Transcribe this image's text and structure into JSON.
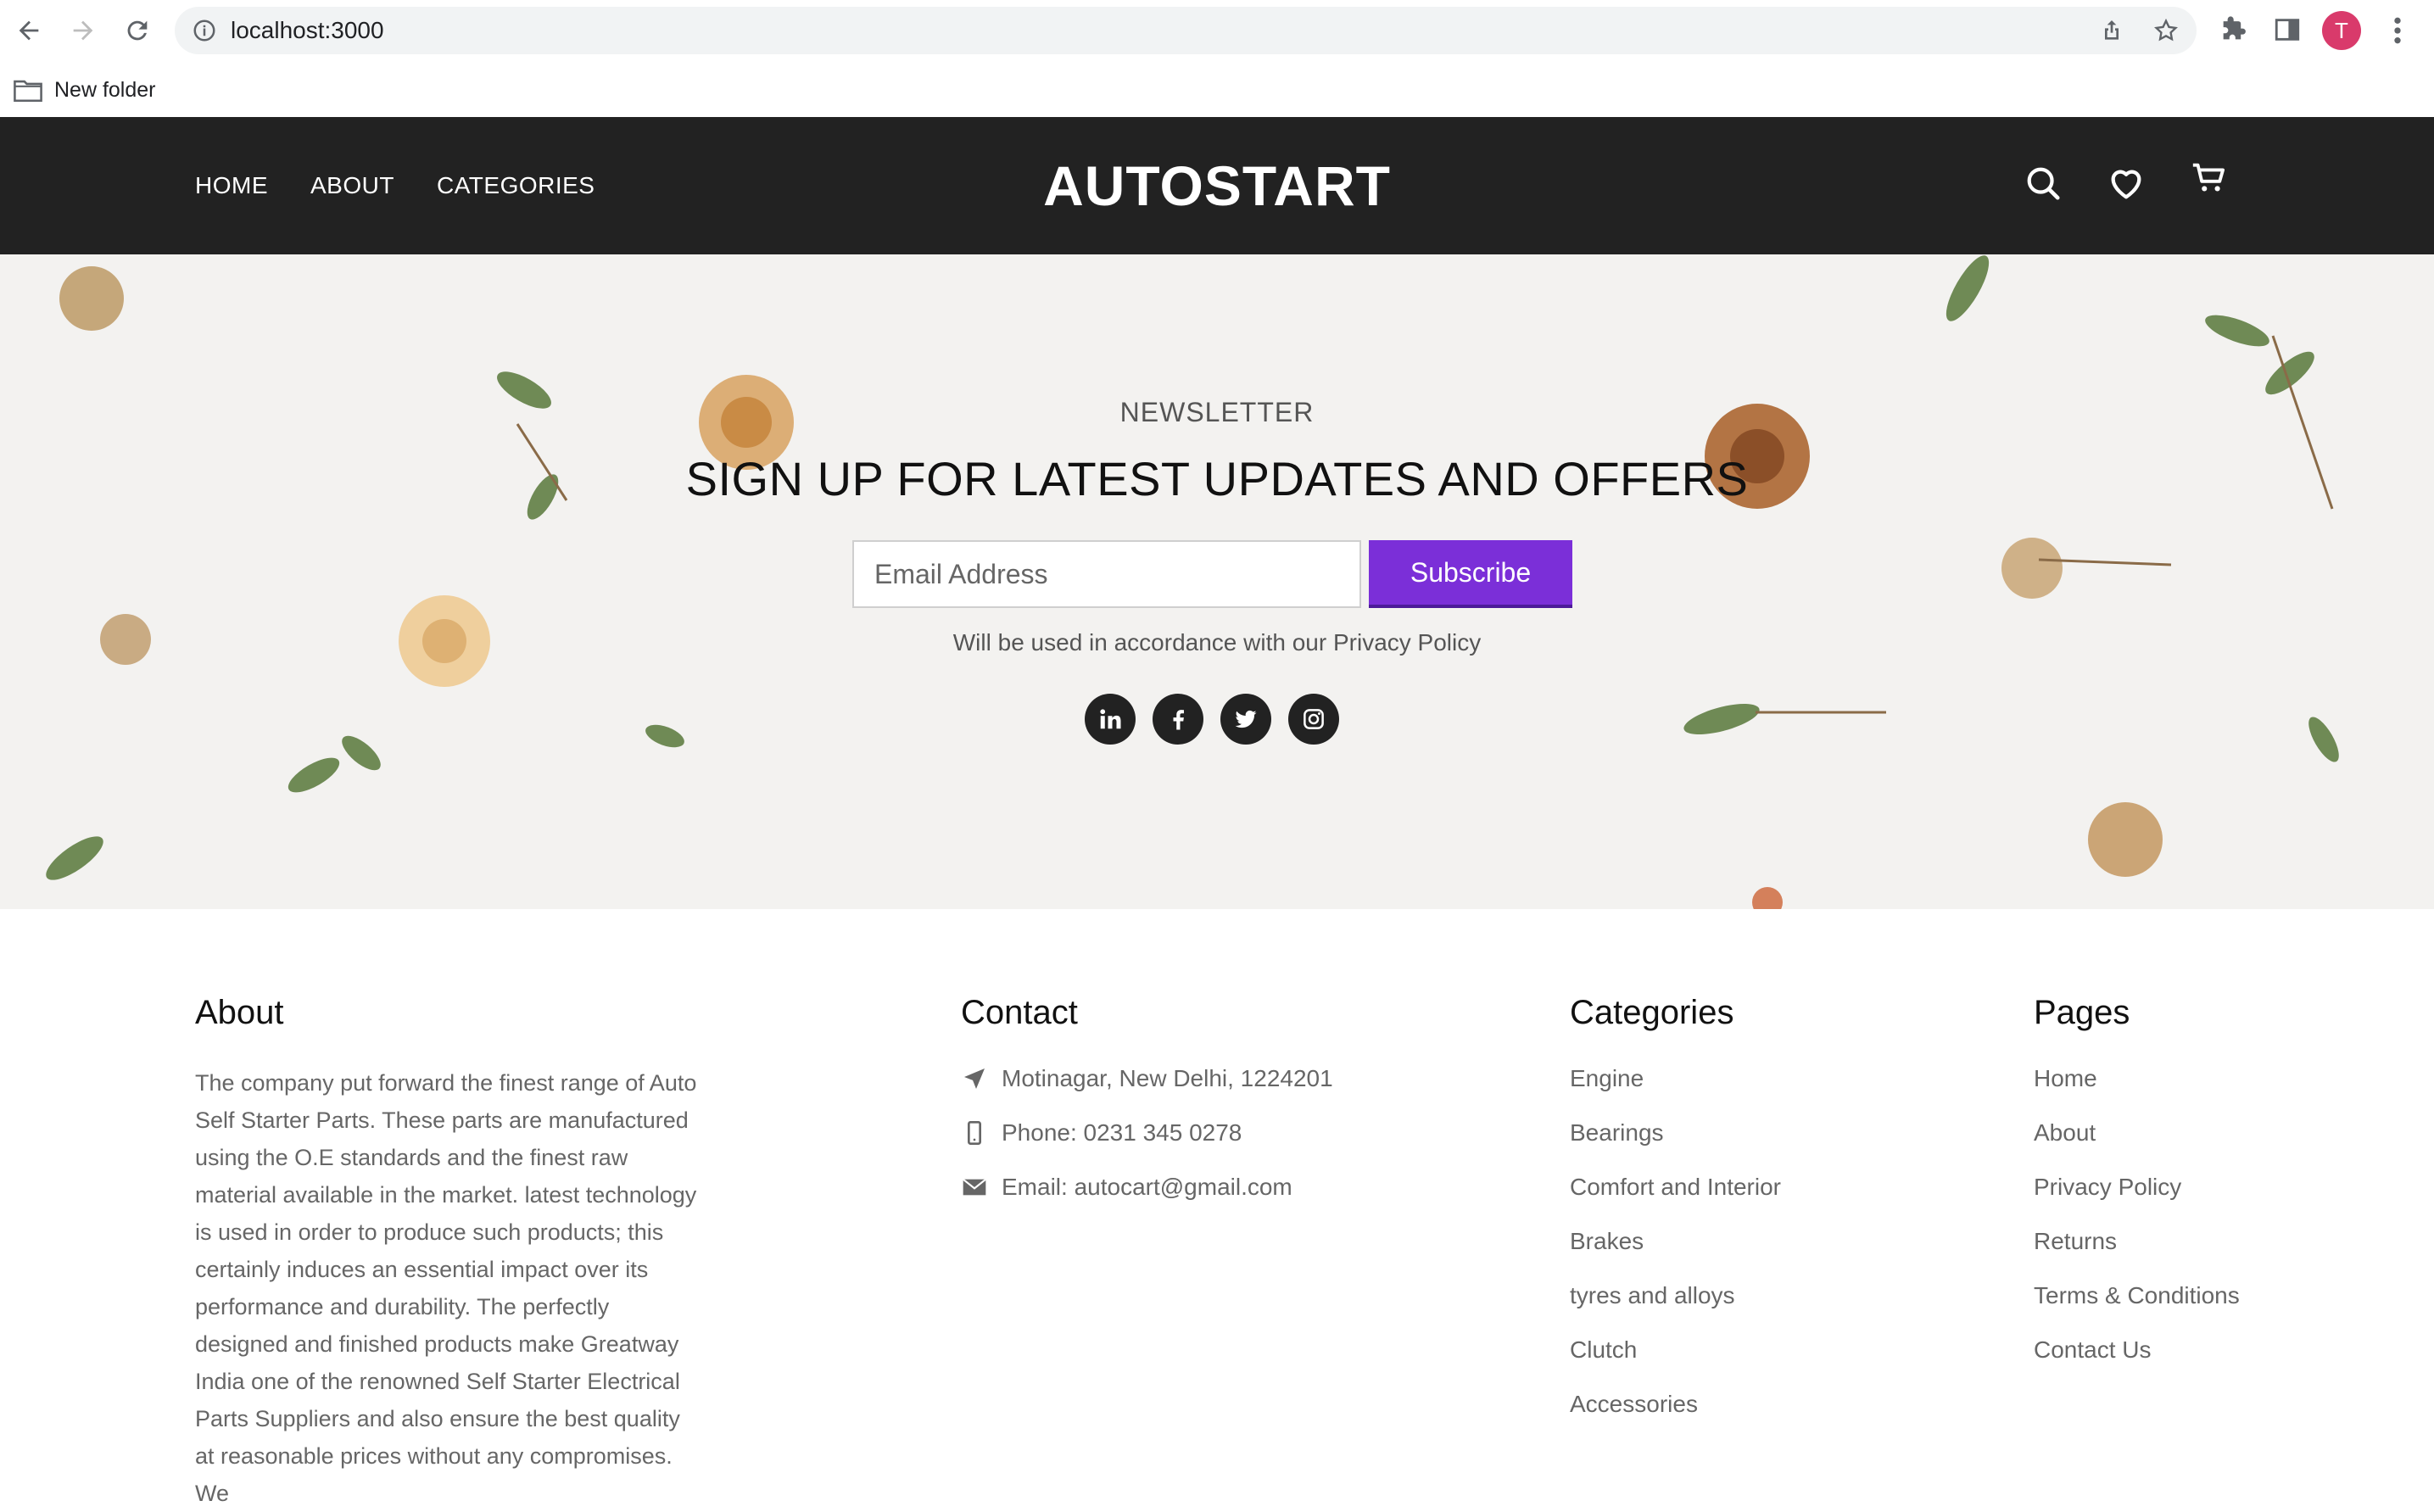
{
  "browser": {
    "url": "localhost:3000",
    "avatar_letter": "T",
    "bookmark": "New folder"
  },
  "header": {
    "nav": [
      "HOME",
      "ABOUT",
      "CATEGORIES"
    ],
    "brand": "AUTOSTART"
  },
  "newsletter": {
    "eyebrow": "NEWSLETTER",
    "title": "SIGN UP FOR LATEST UPDATES AND OFFERS",
    "email_placeholder": "Email Address",
    "button": "Subscribe",
    "note": "Will be used in accordance with our Privacy Policy",
    "social": [
      "linkedin-icon",
      "facebook-icon",
      "twitter-icon",
      "instagram-icon"
    ]
  },
  "footer": {
    "about": {
      "heading": "About",
      "text": "The company put forward the finest range of Auto Self Starter Parts. These parts are manufactured using the O.E standards and the finest raw material available in the market. latest technology is used in order to produce such products; this certainly induces an essential impact over its performance and durability. The perfectly designed and finished products make Greatway India one of the renowned Self Starter Electrical Parts Suppliers and also ensure the best quality at reasonable prices without any compromises. We"
    },
    "contact": {
      "heading": "Contact",
      "address": "Motinagar, New Delhi, 1224201",
      "phone": "Phone: 0231 345 0278",
      "email": "Email: autocart@gmail.com"
    },
    "categories": {
      "heading": "Categories",
      "items": [
        "Engine",
        "Bearings",
        "Comfort and Interior",
        "Brakes",
        "tyres and alloys",
        "Clutch",
        "Accessories"
      ]
    },
    "pages": {
      "heading": "Pages",
      "items": [
        "Home",
        "About",
        "Privacy Policy",
        "Returns",
        "Terms & Conditions",
        "Contact Us"
      ]
    }
  },
  "colors": {
    "header_bg": "#222222",
    "accent": "#7b2fd8",
    "avatar": "#d93a6b"
  }
}
